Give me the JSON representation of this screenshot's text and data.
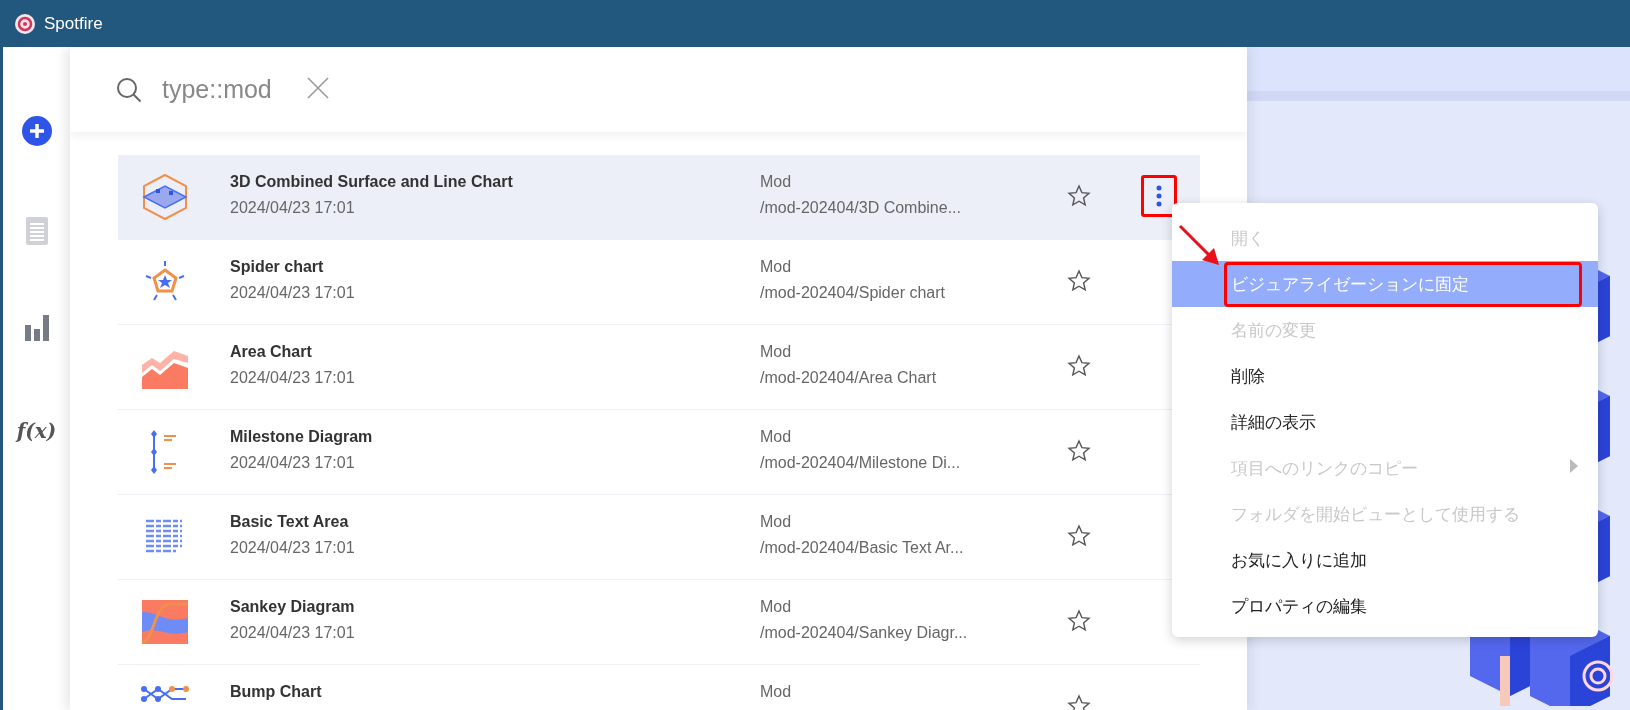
{
  "window": {
    "title": "Spotfire"
  },
  "rail": [
    {
      "kind": "add"
    },
    {
      "kind": "pages"
    },
    {
      "kind": "visualizations"
    },
    {
      "kind": "function",
      "text": "f(x)"
    }
  ],
  "search": {
    "value": "type::mod"
  },
  "rows": [
    {
      "kind": "surface3d",
      "name": "3D Combined Surface and Line Chart",
      "date": "2024/04/23 17:01",
      "type": "Mod",
      "path": "/mod-202404/3D Combine...",
      "starred": false,
      "selected": true,
      "menu_button": {
        "annotated": true
      }
    },
    {
      "kind": "spider",
      "name": "Spider chart",
      "date": "2024/04/23 17:01",
      "type": "Mod",
      "path": "/mod-202404/Spider chart",
      "starred": false,
      "selected": false
    },
    {
      "kind": "area",
      "name": "Area Chart",
      "date": "2024/04/23 17:01",
      "type": "Mod",
      "path": "/mod-202404/Area Chart",
      "starred": false,
      "selected": false
    },
    {
      "kind": "milestone",
      "name": "Milestone Diagram",
      "date": "2024/04/23 17:01",
      "type": "Mod",
      "path": "/mod-202404/Milestone Di...",
      "starred": false,
      "selected": false
    },
    {
      "kind": "text",
      "name": "Basic Text Area",
      "date": "2024/04/23 17:01",
      "type": "Mod",
      "path": "/mod-202404/Basic Text Ar...",
      "starred": false,
      "selected": false
    },
    {
      "kind": "sankey",
      "name": "Sankey Diagram",
      "date": "2024/04/23 17:01",
      "type": "Mod",
      "path": "/mod-202404/Sankey Diagr...",
      "starred": false,
      "selected": false
    },
    {
      "kind": "bump",
      "name": "Bump Chart",
      "type": "Mod",
      "starred": false,
      "selected": false
    }
  ],
  "menu": {
    "items": [
      {
        "label": "開く",
        "disabled": true,
        "selected": false,
        "submenu": false,
        "annotated": false
      },
      {
        "label": "ビジュアライゼーションに固定",
        "disabled": false,
        "selected": true,
        "submenu": false,
        "annotated": true
      },
      {
        "label": "名前の変更",
        "disabled": true,
        "selected": false,
        "submenu": false,
        "annotated": false
      },
      {
        "label": "削除",
        "disabled": false,
        "selected": false,
        "submenu": false,
        "annotated": false
      },
      {
        "label": "詳細の表示",
        "disabled": false,
        "selected": false,
        "submenu": false,
        "annotated": false
      },
      {
        "label": "項目へのリンクのコピー",
        "disabled": true,
        "selected": false,
        "submenu": true,
        "annotated": false
      },
      {
        "label": "フォルダを開始ビューとして使用する",
        "disabled": true,
        "selected": false,
        "submenu": false,
        "annotated": false
      },
      {
        "label": "お気に入りに追加",
        "disabled": false,
        "selected": false,
        "submenu": false,
        "annotated": false
      },
      {
        "label": "プロパティの編集",
        "disabled": false,
        "selected": false,
        "submenu": false,
        "annotated": false
      }
    ]
  }
}
